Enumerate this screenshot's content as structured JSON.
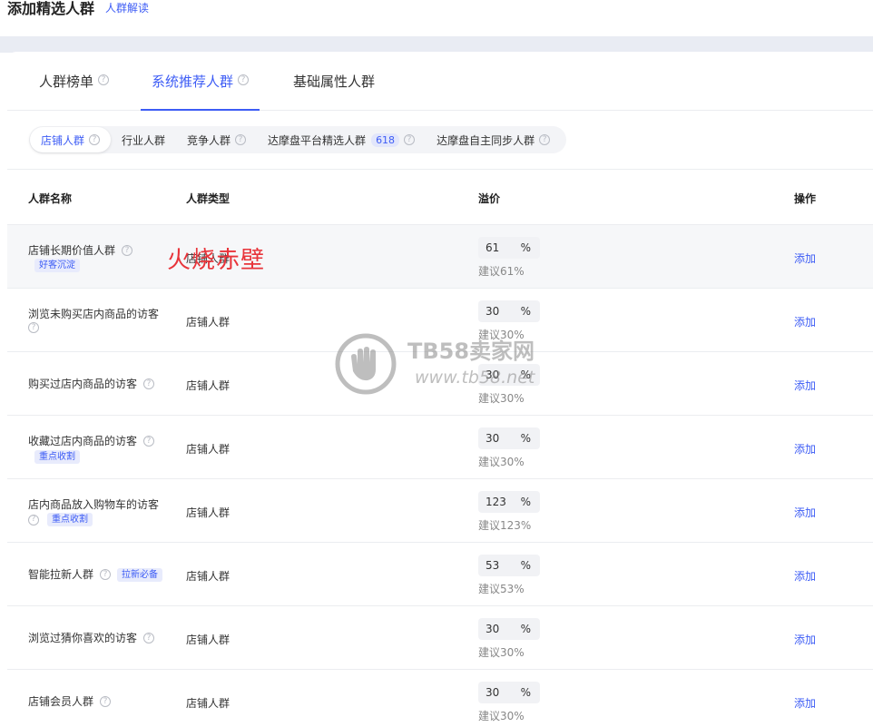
{
  "header": {
    "title": "添加精选人群",
    "link": "人群解读"
  },
  "tabs": [
    {
      "label": "人群榜单",
      "active": false
    },
    {
      "label": "系统推荐人群",
      "active": true
    },
    {
      "label": "基础属性人群",
      "active": false
    }
  ],
  "subtabs": [
    {
      "label": "店铺人群",
      "active": true
    },
    {
      "label": "行业人群"
    },
    {
      "label": "竞争人群"
    },
    {
      "label": "达摩盘平台精选人群",
      "badge": "618"
    },
    {
      "label": "达摩盘自主同步人群"
    }
  ],
  "columns": {
    "name": "人群名称",
    "type": "人群类型",
    "bid": "溢价",
    "op": "操作"
  },
  "rows": [
    {
      "name": "店铺长期价值人群",
      "tag": "好客沉淀",
      "type": "店铺人群",
      "bid": "61",
      "unit": "%",
      "suggest": "建议61%",
      "op": "添加"
    },
    {
      "name": "浏览未购买店内商品的访客",
      "type": "店铺人群",
      "bid": "30",
      "unit": "%",
      "suggest": "建议30%",
      "op": "添加"
    },
    {
      "name": "购买过店内商品的访客",
      "type": "店铺人群",
      "bid": "30",
      "unit": "%",
      "suggest": "建议30%",
      "op": "添加"
    },
    {
      "name": "收藏过店内商品的访客",
      "tag": "重点收割",
      "type": "店铺人群",
      "bid": "30",
      "unit": "%",
      "suggest": "建议30%",
      "op": "添加"
    },
    {
      "name": "店内商品放入购物车的访客",
      "tag": "重点收割",
      "type": "店铺人群",
      "bid": "123",
      "unit": "%",
      "suggest": "建议123%",
      "op": "添加"
    },
    {
      "name": "智能拉新人群",
      "tag": "拉新必备",
      "type": "店铺人群",
      "bid": "53",
      "unit": "%",
      "suggest": "建议53%",
      "op": "添加"
    },
    {
      "name": "浏览过猜你喜欢的访客",
      "type": "店铺人群",
      "bid": "30",
      "unit": "%",
      "suggest": "建议30%",
      "op": "添加"
    },
    {
      "name": "店铺会员人群",
      "type": "店铺人群",
      "bid": "30",
      "unit": "%",
      "suggest": "建议30%",
      "op": "添加"
    }
  ],
  "overlay": {
    "text": "火烧赤壁"
  },
  "watermark": {
    "line1": "TB58卖家网",
    "line2": "www.tb58.net"
  },
  "icons": {
    "help": "question-circle-icon"
  },
  "colors": {
    "accent": "#3d5cf5",
    "overlay": "#e8343a"
  }
}
